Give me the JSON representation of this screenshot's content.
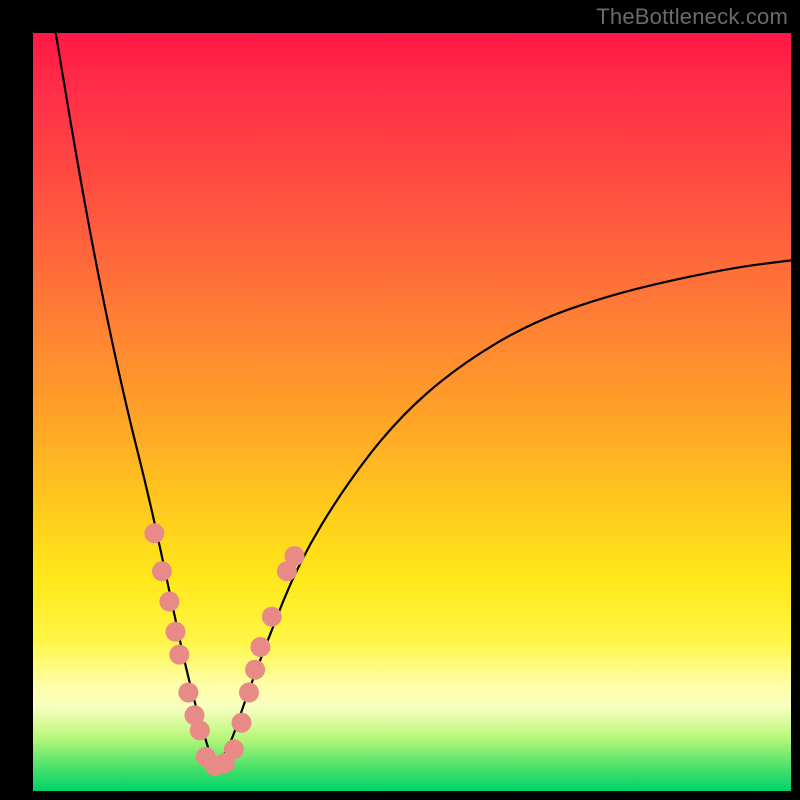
{
  "watermark": "TheBottleneck.com",
  "colors": {
    "frame": "#000000",
    "curve": "#000000",
    "dot": "#e88a86",
    "gradient_top": "#ff1846",
    "gradient_bottom": "#00d36a"
  },
  "chart_data": {
    "type": "line",
    "title": "",
    "xlabel": "",
    "ylabel": "",
    "xlim": [
      0,
      100
    ],
    "ylim": [
      0,
      100
    ],
    "note": "Axes unlabeled; values are percent of plot area (0 at left/bottom, 100 at right/top). Curve depicts a V-shaped bottleneck funnel; minimum near x≈24.",
    "series": [
      {
        "name": "left_branch",
        "x": [
          3,
          6,
          9,
          12,
          15,
          17,
          18.5,
          20,
          21.5,
          23,
          24
        ],
        "y": [
          100,
          82,
          66,
          52,
          40,
          31,
          24,
          17,
          11,
          6,
          3
        ]
      },
      {
        "name": "right_branch",
        "x": [
          24,
          26,
          28,
          31,
          35,
          41,
          48,
          56,
          66,
          78,
          92,
          100
        ],
        "y": [
          3,
          6,
          12,
          20,
          30,
          40,
          49,
          56,
          62,
          66,
          69,
          70
        ]
      }
    ],
    "markers": [
      {
        "series": "left_branch",
        "x": 16.0,
        "y": 34
      },
      {
        "series": "left_branch",
        "x": 17.0,
        "y": 29
      },
      {
        "series": "left_branch",
        "x": 18.0,
        "y": 25
      },
      {
        "series": "left_branch",
        "x": 18.8,
        "y": 21
      },
      {
        "series": "left_branch",
        "x": 19.3,
        "y": 18
      },
      {
        "series": "left_branch",
        "x": 20.5,
        "y": 13
      },
      {
        "series": "left_branch",
        "x": 21.3,
        "y": 10
      },
      {
        "series": "left_branch",
        "x": 22.0,
        "y": 8
      },
      {
        "series": "bottom",
        "x": 22.8,
        "y": 4.5
      },
      {
        "series": "bottom",
        "x": 24.0,
        "y": 3.3
      },
      {
        "series": "bottom",
        "x": 25.3,
        "y": 3.7
      },
      {
        "series": "bottom",
        "x": 26.5,
        "y": 5.5
      },
      {
        "series": "right_branch",
        "x": 27.5,
        "y": 9
      },
      {
        "series": "right_branch",
        "x": 28.5,
        "y": 13
      },
      {
        "series": "right_branch",
        "x": 29.3,
        "y": 16
      },
      {
        "series": "right_branch",
        "x": 30.0,
        "y": 19
      },
      {
        "series": "right_branch",
        "x": 31.5,
        "y": 23
      },
      {
        "series": "right_branch",
        "x": 33.5,
        "y": 29
      },
      {
        "series": "right_branch",
        "x": 34.5,
        "y": 31
      }
    ]
  }
}
